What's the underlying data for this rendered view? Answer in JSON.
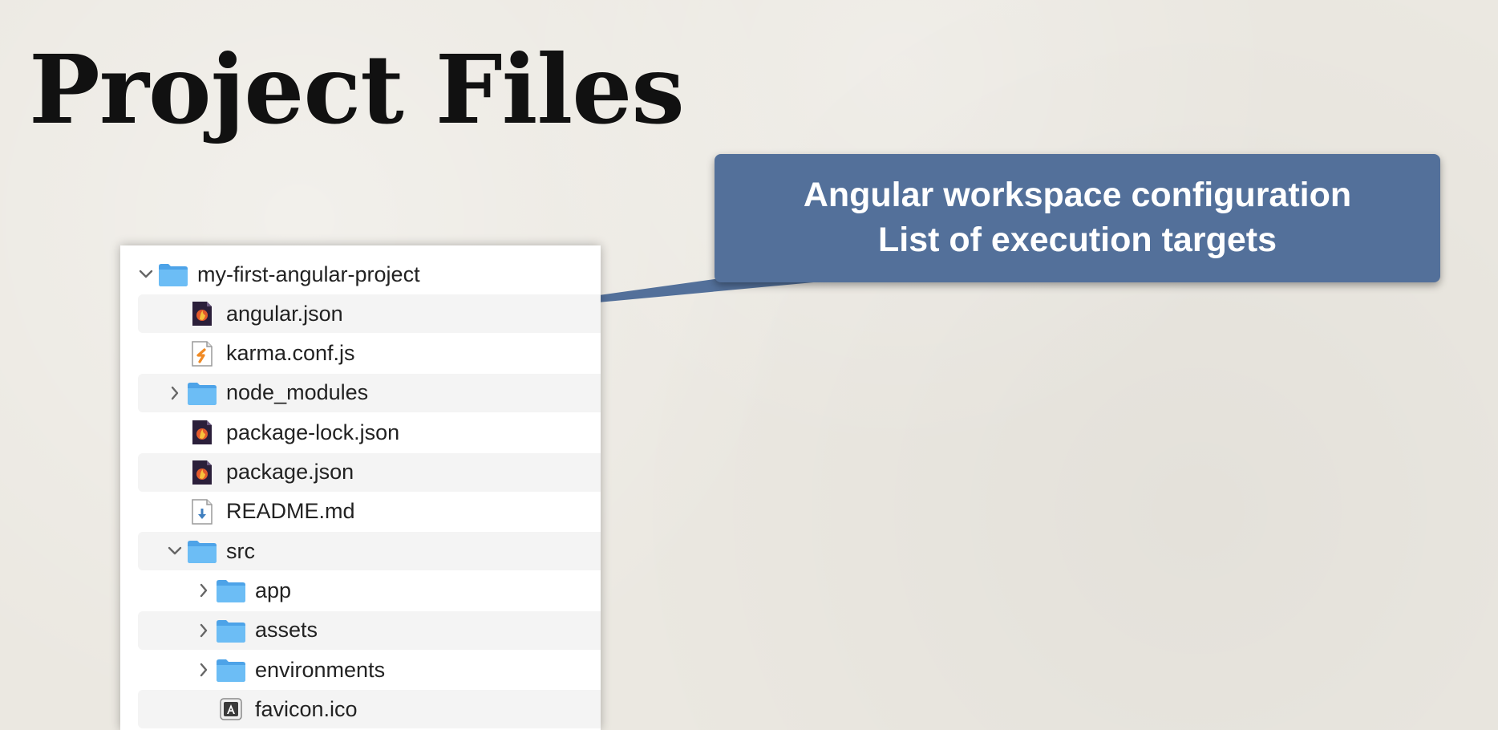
{
  "slide": {
    "title": "Project Files"
  },
  "callout": {
    "line1": "Angular workspace configuration",
    "line2": "List of execution targets",
    "color": "#53709a"
  },
  "file_tree": {
    "items": [
      {
        "label": "my-first-angular-project",
        "icon": "folder-icon",
        "expander": "chevron-down-icon",
        "depth": 0
      },
      {
        "label": "angular.json",
        "icon": "json-file-icon",
        "depth": 1
      },
      {
        "label": "karma.conf.js",
        "icon": "javascript-file-icon",
        "depth": 1
      },
      {
        "label": "node_modules",
        "icon": "folder-icon",
        "expander": "chevron-right-icon",
        "depth": 1
      },
      {
        "label": "package-lock.json",
        "icon": "json-file-icon",
        "depth": 1
      },
      {
        "label": "package.json",
        "icon": "json-file-icon",
        "depth": 1
      },
      {
        "label": "README.md",
        "icon": "markdown-file-icon",
        "depth": 1
      },
      {
        "label": "src",
        "icon": "folder-icon",
        "expander": "chevron-down-icon",
        "depth": 1
      },
      {
        "label": "app",
        "icon": "folder-icon",
        "expander": "chevron-right-icon",
        "depth": 2
      },
      {
        "label": "assets",
        "icon": "folder-icon",
        "expander": "chevron-right-icon",
        "depth": 2
      },
      {
        "label": "environments",
        "icon": "folder-icon",
        "expander": "chevron-right-icon",
        "depth": 2
      },
      {
        "label": "favicon.ico",
        "icon": "angular-favicon-icon",
        "depth": 2
      }
    ]
  }
}
